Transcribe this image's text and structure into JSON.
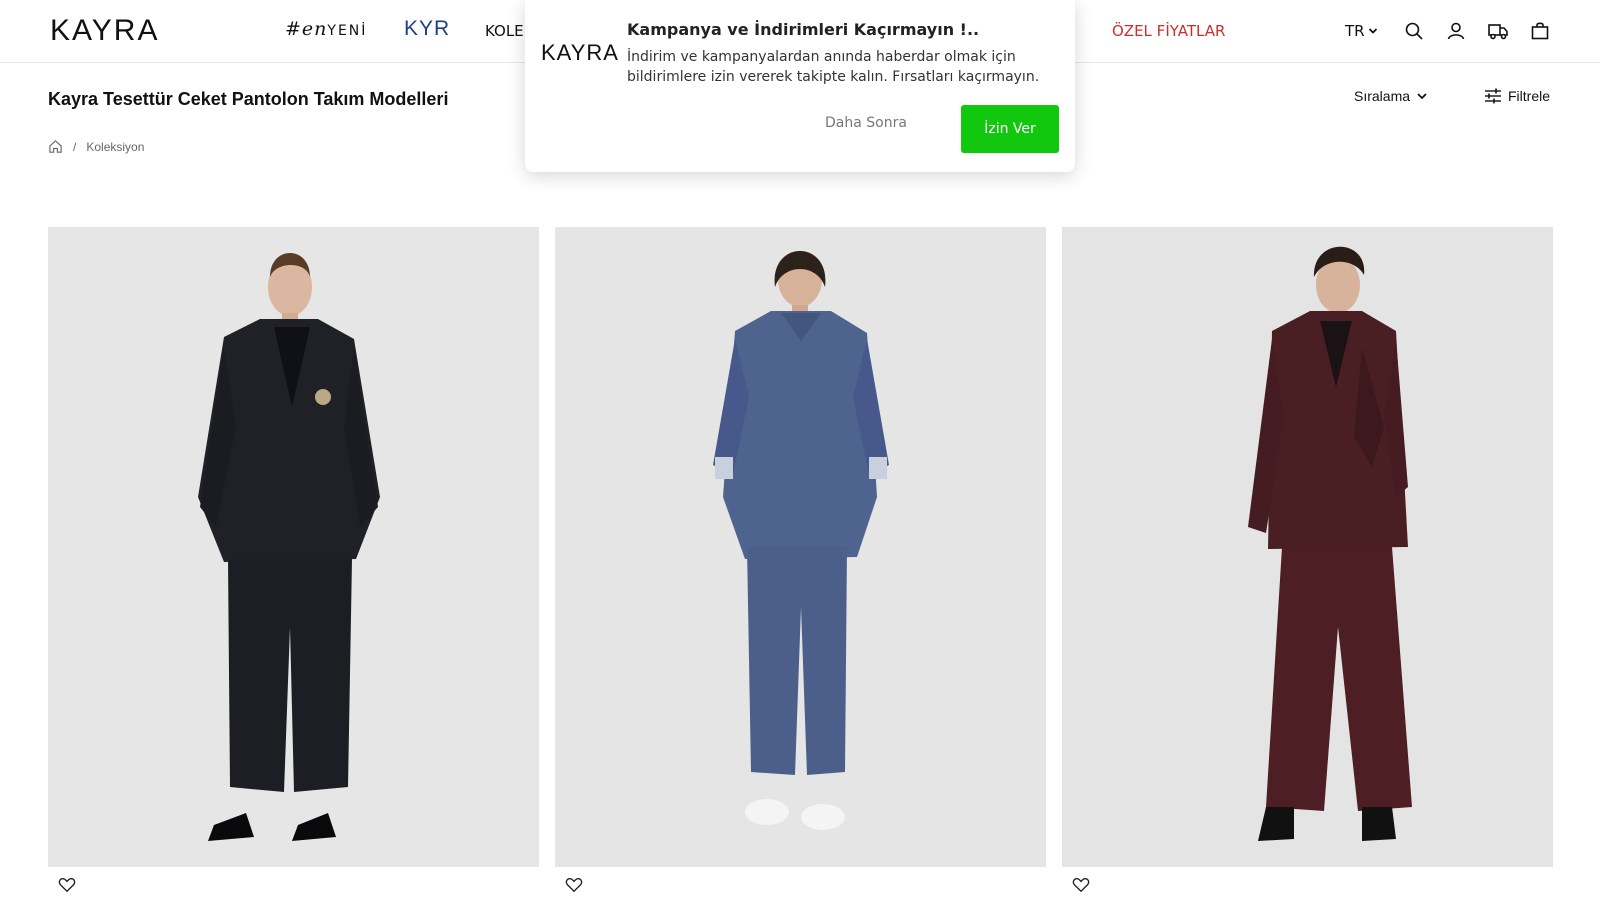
{
  "header": {
    "logo": "KAYRA",
    "nav": {
      "enyeni_prefix": "#",
      "enyeni_en": "en",
      "enyeni_yeni": "YENİ",
      "kyr": "KYR",
      "koleksiyon": "KOLEK",
      "ozel_fiyatlar": "ÖZEL FİYATLAR"
    },
    "lang": "TR",
    "icons": [
      "search-icon",
      "user-icon",
      "truck-icon",
      "bag-icon"
    ]
  },
  "page": {
    "title": "Kayra Tesettür Ceket Pantolon Takım Modelleri",
    "sort_label": "Sıralama",
    "filter_label": "Filtrele"
  },
  "breadcrumb": {
    "home_icon": "home-icon",
    "separator": "/",
    "current": "Koleksiyon"
  },
  "products": [
    {
      "color": "#1f2127",
      "description_color": "black"
    },
    {
      "color": "#4e638e",
      "description_color": "navy-blue"
    },
    {
      "color": "#4a1f24",
      "description_color": "burgundy"
    }
  ],
  "popup": {
    "logo": "KAYRA",
    "title": "Kampanya ve İndirimleri Kaçırmayın !..",
    "text": "İndirim ve kampanyalardan anında haberdar olmak için bildirimlere izin vererek takipte kalın. Fırsatları kaçırmayın.",
    "later_label": "Daha Sonra",
    "allow_label": "İzin Ver",
    "accent": "#12c80f"
  },
  "colors": {
    "sale_red": "#c9302c",
    "kyr_blue": "#1e3f8a"
  }
}
